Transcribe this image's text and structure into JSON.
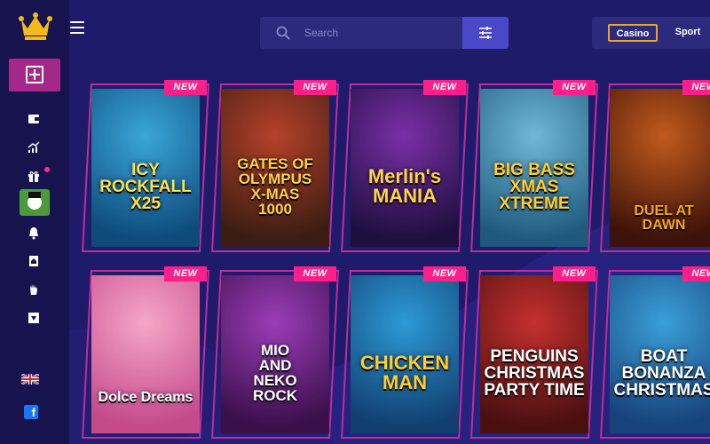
{
  "header": {
    "search_placeholder": "Search",
    "tabs": [
      {
        "label": "Casino",
        "active": true
      },
      {
        "label": "Sport",
        "active": false
      }
    ]
  },
  "sidebar": {
    "icons": [
      "wallet-icon",
      "trending-icon",
      "gift-icon",
      "promo-avatar",
      "bell-icon",
      "ticket-icon",
      "hand-icon",
      "store-icon"
    ],
    "language": "en-GB",
    "social": "f"
  },
  "games": [
    {
      "badge": "NEW",
      "title": [
        "ICY",
        "ROCKFALL",
        "X25"
      ],
      "colors": [
        "#3aa6d8",
        "#0e4a7a"
      ]
    },
    {
      "badge": "NEW",
      "title": [
        "GATES OF",
        "OLYMPUS",
        "X-MAS",
        "1000"
      ],
      "colors": [
        "#b6412b",
        "#3b1d12"
      ]
    },
    {
      "badge": "NEW",
      "title": [
        "Merlin's",
        "MANIA"
      ],
      "colors": [
        "#7a2fa8",
        "#1e0f3e"
      ]
    },
    {
      "badge": "NEW",
      "title": [
        "BIG BASS",
        "XMAS",
        "XTREME"
      ],
      "colors": [
        "#6fb7d8",
        "#1f5a7c"
      ]
    },
    {
      "badge": "NEW",
      "title": [
        "DUEL AT DAWN"
      ],
      "colors": [
        "#c25a1e",
        "#3d1208"
      ]
    },
    {
      "badge": "NEW",
      "title": [
        "Dolce Dreams"
      ],
      "colors": [
        "#f6a6c8",
        "#c44a8a"
      ]
    },
    {
      "badge": "NEW",
      "title": [
        "MIO",
        "AND",
        "NEKO",
        "ROCK"
      ],
      "colors": [
        "#9b3db8",
        "#3a0f4a"
      ]
    },
    {
      "badge": "NEW",
      "title": [
        "CHICKEN",
        "MAN"
      ],
      "colors": [
        "#2d9ad6",
        "#123f70"
      ]
    },
    {
      "badge": "NEW",
      "title": [
        "PENGUINS",
        "CHRISTMAS",
        "PARTY TIME"
      ],
      "colors": [
        "#c5302e",
        "#4a1010"
      ]
    },
    {
      "badge": "NEW",
      "title": [
        "BOAT",
        "BONANZA",
        "CHRISTMAS"
      ],
      "colors": [
        "#3b9fd8",
        "#17427a"
      ]
    }
  ]
}
